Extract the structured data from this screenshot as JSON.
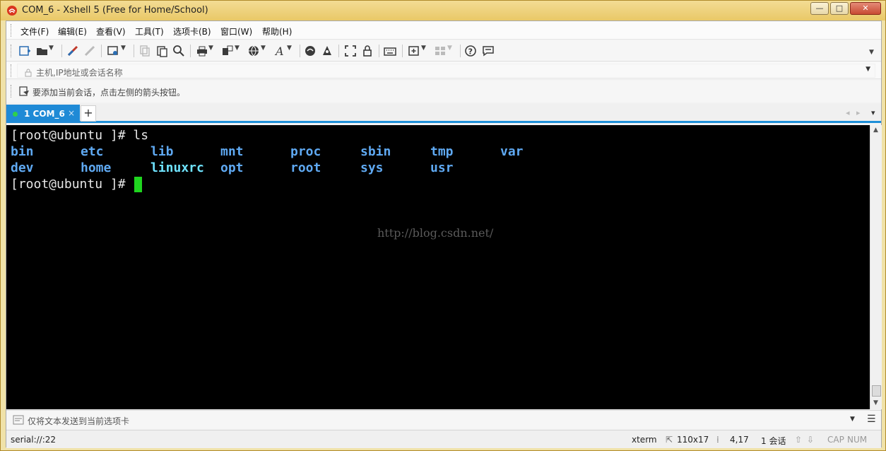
{
  "window": {
    "title": "COM_6 - Xshell 5 (Free for Home/School)",
    "minimize_label": "—",
    "maximize_label": "□",
    "close_label": "✕"
  },
  "menu": {
    "items": [
      "文件(F)",
      "编辑(E)",
      "查看(V)",
      "工具(T)",
      "选项卡(B)",
      "窗口(W)",
      "帮助(H)"
    ]
  },
  "address_bar": {
    "placeholder": "主机,IP地址或会话名称"
  },
  "hint_bar": {
    "text": "要添加当前会话，点击左侧的箭头按钮。"
  },
  "tabs": {
    "items": [
      {
        "number": "1",
        "label": "1 COM_6",
        "close": "×",
        "active": true
      }
    ],
    "add_label": "+",
    "prev_label": "◂",
    "next_label": "▸",
    "menu_label": "▾"
  },
  "terminal": {
    "prompt1": "[root@ubuntu ]# ls",
    "row1": [
      "bin",
      "etc",
      "lib",
      "mnt",
      "proc",
      "sbin",
      "tmp",
      "var"
    ],
    "row2": [
      "dev",
      "home",
      "linuxrc",
      "opt",
      "root",
      "sys",
      "usr"
    ],
    "prompt2": "[root@ubuntu ]#",
    "watermark": "http://blog.csdn.net/",
    "colors": {
      "background": "#000000",
      "text": "#e6e6e6",
      "dir": "#5fa9f2",
      "exec": "#6fe3ff",
      "cursor": "#1fd51f"
    }
  },
  "send_bar": {
    "text": "仅将文本发送到当前选项卡"
  },
  "status": {
    "connection": "serial://:22",
    "term_type": "xterm",
    "size": "110x17",
    "position": "4,17",
    "sessions": "1 会话",
    "caps": "CAP",
    "num": "NUM"
  },
  "colors": {
    "title_bar": "#e9c867",
    "tab_active": "#1f8ad6",
    "tab_underline": "#1e8fd8"
  }
}
